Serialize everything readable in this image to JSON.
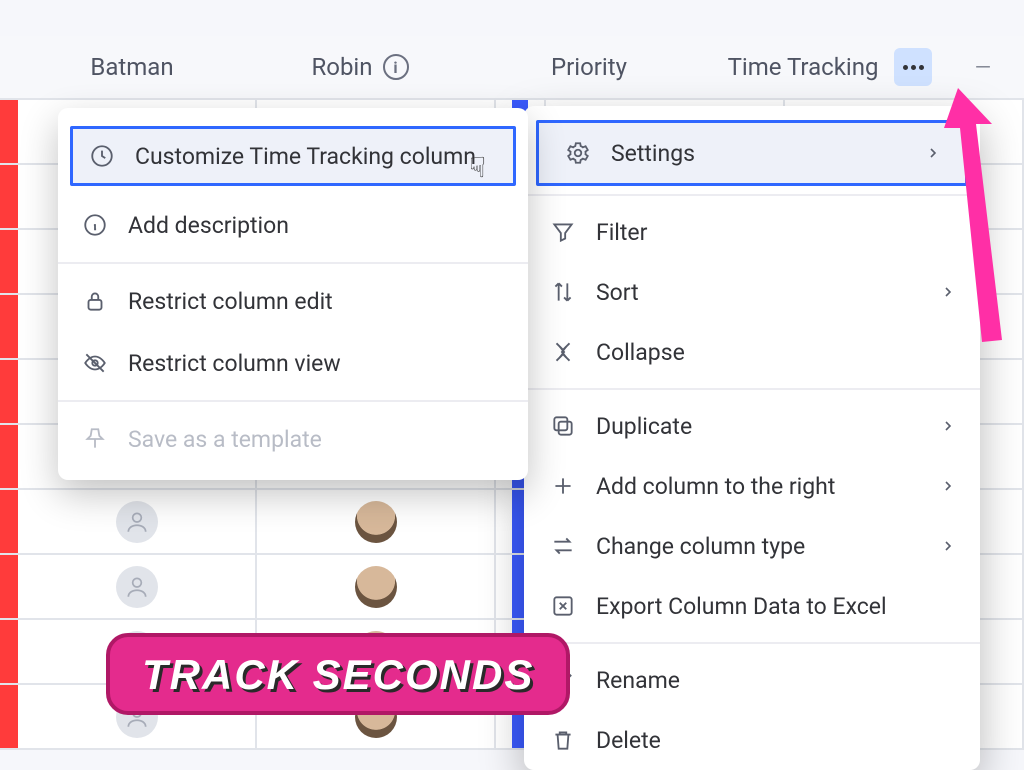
{
  "header": {
    "cols": [
      "Batman",
      "Robin",
      "Priority",
      "Time Tracking"
    ]
  },
  "leftMenu": {
    "customize": "Customize Time Tracking column",
    "addDesc": "Add description",
    "restrictEdit": "Restrict column edit",
    "restrictView": "Restrict column view",
    "saveTemplate": "Save as a template"
  },
  "rightMenu": {
    "settings": "Settings",
    "filter": "Filter",
    "sort": "Sort",
    "collapse": "Collapse",
    "duplicate": "Duplicate",
    "addRight": "Add column to the right",
    "changeType": "Change column type",
    "export": "Export Column Data to Excel",
    "rename": "Rename",
    "delete": "Delete"
  },
  "overlay": {
    "badge": "TRACK SECONDS"
  },
  "colors": {
    "rowStrip": "#ff3b3b",
    "blueStrip": "#3b5bff",
    "accent": "#2f67ff",
    "badgeBg": "#e42b8d",
    "arrow": "#ff2fa6"
  }
}
